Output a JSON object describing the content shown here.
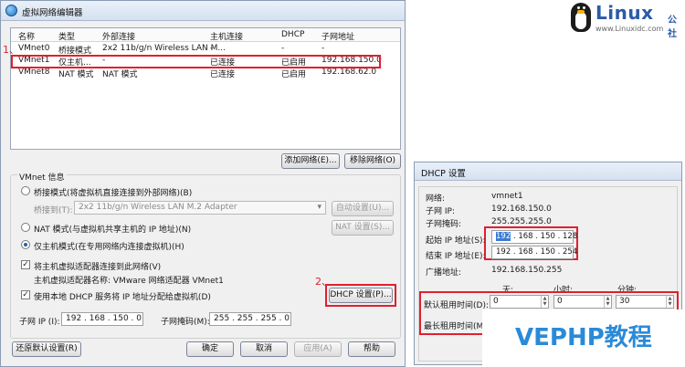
{
  "window": {
    "title": "虚拟网络编辑器"
  },
  "table": {
    "headers": [
      "名称",
      "类型",
      "外部连接",
      "主机连接",
      "DHCP",
      "子网地址"
    ],
    "rows": [
      [
        "VMnet0",
        "桥接模式",
        "2x2 11b/g/n Wireless LAN M...",
        "-",
        "-",
        "-"
      ],
      [
        "VMnet1",
        "仅主机...",
        "-",
        "已连接",
        "已启用",
        "192.168.150.0"
      ],
      [
        "VMnet8",
        "NAT 模式",
        "NAT 模式",
        "已连接",
        "已启用",
        "192.168.62.0"
      ]
    ]
  },
  "annotations": {
    "one": "1、",
    "two": "2、"
  },
  "buttons": {
    "add_network": "添加网络(E)...",
    "remove_network": "移除网络(O)",
    "auto_settings": "自动设置(U)...",
    "nat_settings": "NAT 设置(S)...",
    "dhcp_settings": "DHCP 设置(P)...",
    "restore_defaults": "还原默认设置(R)",
    "ok": "确定",
    "cancel": "取消",
    "apply": "应用(A)",
    "help": "帮助"
  },
  "vmnet_info": {
    "title": "VMnet 信息",
    "bridged": "桥接模式(将虚拟机直接连接到外部网络)(B)",
    "bridged_to_label": "桥接到(T):",
    "bridged_to_value": "2x2 11b/g/n Wireless LAN M.2 Adapter",
    "nat": "NAT 模式(与虚拟机共享主机的 IP 地址)(N)",
    "host_only": "仅主机模式(在专用网络内连接虚拟机)(H)",
    "connect_adapter": "将主机虚拟适配器连接到此网络(V)",
    "adapter_name_label": "主机虚拟适配器名称: VMware 网络适配器 VMnet1",
    "use_dhcp": "使用本地 DHCP 服务将 IP 地址分配给虚拟机(D)",
    "subnet_ip_label": "子网 IP (I):",
    "subnet_ip": "192 . 168 . 150 .  0",
    "subnet_mask_label": "子网掩码(M):",
    "subnet_mask": "255 . 255 . 255 .  0"
  },
  "dhcp": {
    "title": "DHCP 设置",
    "network_label": "网络:",
    "network_value": "vmnet1",
    "subnet_ip_label": "子网 IP:",
    "subnet_ip_value": "192.168.150.0",
    "subnet_mask_label": "子网掩码:",
    "subnet_mask_value": "255.255.255.0",
    "start_ip_label": "起始 IP 地址(S):",
    "start_ip_first": "192",
    "start_ip_rest": " . 168 . 150 . 128",
    "end_ip_label": "结束 IP 地址(E):",
    "end_ip": "192 . 168 . 150 . 254",
    "broadcast_label": "广播地址:",
    "broadcast_value": "192.168.150.255",
    "days_label": "天:",
    "hours_label": "小时:",
    "minutes_label": "分钟:",
    "default_lease_label": "默认租用时间(D):",
    "max_lease_label": "最长租用时间(M):",
    "days": "0",
    "hours": "0",
    "minutes": "30"
  },
  "brand": {
    "name": "Linux",
    "cn": "公社",
    "url": "www.Linuxidc.com"
  },
  "watermark": {
    "text": "VEPHP教程"
  },
  "colors": {
    "highlight": "#e0202f",
    "brand": "#2c5aa8",
    "watermark": "#2a8ad8"
  }
}
